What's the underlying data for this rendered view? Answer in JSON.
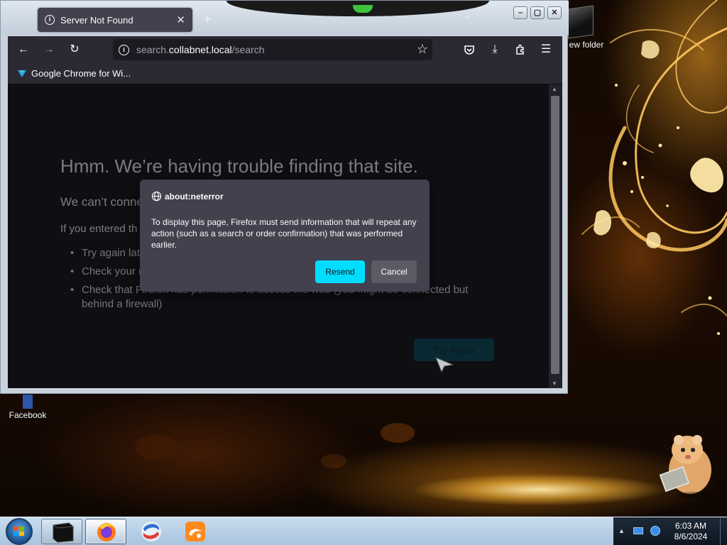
{
  "desktop": {
    "icons": [
      {
        "label": "Facebook"
      },
      {
        "label": "New folder",
        "visible_label": "ew folder"
      }
    ]
  },
  "browser": {
    "tab": {
      "title": "Server Not Found",
      "icon": "info-icon"
    },
    "url": {
      "prefix": "search.",
      "host": "collabnet.local",
      "path": "/search"
    },
    "bookmarks": [
      {
        "label": "Google Chrome for Wi...",
        "icon": "download-arrow-icon"
      }
    ]
  },
  "error_page": {
    "title": "Hmm. We’re having trouble finding that site.",
    "subtitle": "We can’t conne",
    "hint": "If you entered th",
    "suggestions": [
      "Try again lat",
      "Check your n",
      "Check that Firefox has permission to access the web (you might be connected but behind a firewall)"
    ],
    "try_again_label": "Try Again"
  },
  "dialog": {
    "origin": "about:neterror",
    "message": "To display this page, Firefox must send information that will repeat any action (such as a search or order confirmation) that was performed earlier.",
    "resend_label": "Resend",
    "cancel_label": "Cancel"
  },
  "taskbar": {
    "clock_time": "6:03 AM",
    "clock_date": "8/6/2024"
  },
  "colors": {
    "resend_accent": "#00ddff",
    "dialog_bg": "#42414d",
    "page_bg": "#1c1b22"
  }
}
